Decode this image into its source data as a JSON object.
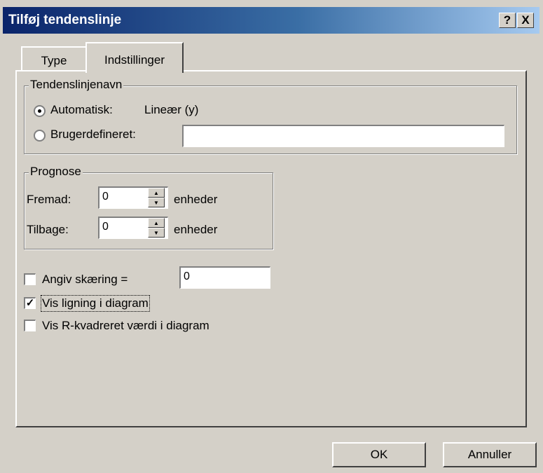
{
  "window": {
    "title": "Tilføj tendenslinje",
    "help": "?",
    "close": "X"
  },
  "tabs": [
    {
      "label": "Type"
    },
    {
      "label": "Indstillinger"
    }
  ],
  "trendline_name": {
    "legend": "Tendenslinjenavn",
    "automatic": {
      "label": "Automatisk:",
      "value": "Lineær (y)",
      "selected": true
    },
    "custom": {
      "label": "Brugerdefineret:",
      "value": "",
      "selected": false
    }
  },
  "forecast": {
    "legend": "Prognose",
    "forward": {
      "label": "Fremad:",
      "value": "0",
      "unit": "enheder"
    },
    "backward": {
      "label": "Tilbage:",
      "value": "0",
      "unit": "enheder"
    }
  },
  "options": {
    "intercept": {
      "label": "Angiv skæring =",
      "value": "0",
      "checked": false
    },
    "show_equation": {
      "label": "Vis ligning i diagram",
      "checked": true
    },
    "show_rsquared": {
      "label": "Vis R-kvadreret værdi i diagram",
      "checked": false
    }
  },
  "buttons": {
    "ok": "OK",
    "cancel": "Annuller"
  }
}
